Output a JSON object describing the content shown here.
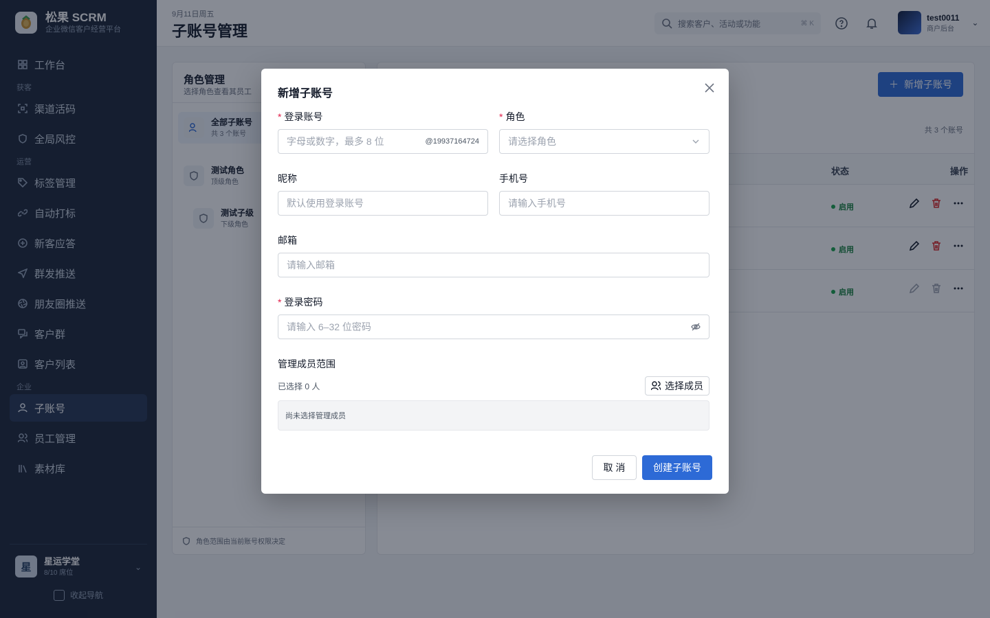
{
  "app": {
    "name": "松果 SCRM",
    "subtitle": "企业微信客户经营平台"
  },
  "sidebar": {
    "items": [
      {
        "label": "工作台",
        "icon": "dashboard-icon"
      },
      {
        "section": "获客"
      },
      {
        "label": "渠道活码",
        "icon": "qrcode-icon"
      },
      {
        "label": "全局风控",
        "icon": "shield-icon"
      },
      {
        "section": "运营"
      },
      {
        "label": "标签管理",
        "icon": "tag-icon"
      },
      {
        "label": "自动打标",
        "icon": "link-icon"
      },
      {
        "label": "新客应答",
        "icon": "reply-icon"
      },
      {
        "label": "群发推送",
        "icon": "send-icon"
      },
      {
        "label": "朋友圈推送",
        "icon": "aperture-icon"
      },
      {
        "label": "客户群",
        "icon": "chat-group-icon"
      },
      {
        "label": "客户列表",
        "icon": "contact-icon"
      },
      {
        "section": "企业"
      },
      {
        "label": "子账号",
        "icon": "user-icon",
        "active": true
      },
      {
        "label": "员工管理",
        "icon": "users-icon"
      },
      {
        "label": "素材库",
        "icon": "library-icon"
      }
    ],
    "org": {
      "avatar": "星",
      "name": "星运学堂",
      "seats": "8/10 席位"
    },
    "collapse_label": "收起导航"
  },
  "header": {
    "date": "9月11日周五",
    "title": "子账号管理",
    "search_placeholder": "搜索客户、活动或功能",
    "search_kbd": "⌘ K",
    "user": {
      "name": "test0011",
      "role": "商户后台"
    }
  },
  "roles_panel": {
    "title": "角色管理",
    "subtitle": "选择角色查看其员工",
    "roles": [
      {
        "name": "全部子账号",
        "sub": "共 3 个账号",
        "active": true
      },
      {
        "name": "测试角色",
        "sub": "顶级角色"
      },
      {
        "name": "测试子级",
        "sub": "下级角色"
      }
    ],
    "footer": "角色范围由当前账号权限决定"
  },
  "accounts_panel": {
    "add_label": "新增子账号",
    "total": "共 3 个账号",
    "columns": {
      "status": "状态",
      "actions": "操作"
    },
    "rows": [
      {
        "status": "启用"
      },
      {
        "status": "启用"
      },
      {
        "status": "启用"
      }
    ]
  },
  "modal": {
    "title": "新增子账号",
    "login": {
      "label": "登录账号",
      "placeholder": "字母或数字，最多 8 位",
      "suffix": "@19937164724"
    },
    "role": {
      "label": "角色",
      "placeholder": "请选择角色"
    },
    "nickname": {
      "label": "昵称",
      "placeholder": "默认使用登录账号"
    },
    "phone": {
      "label": "手机号",
      "placeholder": "请输入手机号"
    },
    "email": {
      "label": "邮箱",
      "placeholder": "请输入邮箱"
    },
    "password": {
      "label": "登录密码",
      "placeholder": "请输入 6–32 位密码"
    },
    "scope": {
      "label": "管理成员范围",
      "count": "已选择 0 人",
      "pick_label": "选择成员",
      "empty": "尚未选择管理成员"
    },
    "cancel_label": "取 消",
    "create_label": "创建子账号"
  },
  "colors": {
    "primary": "#2d6ad6",
    "sidebar": "#1a2436",
    "required": "#e11d48",
    "status": "#16a34a"
  }
}
